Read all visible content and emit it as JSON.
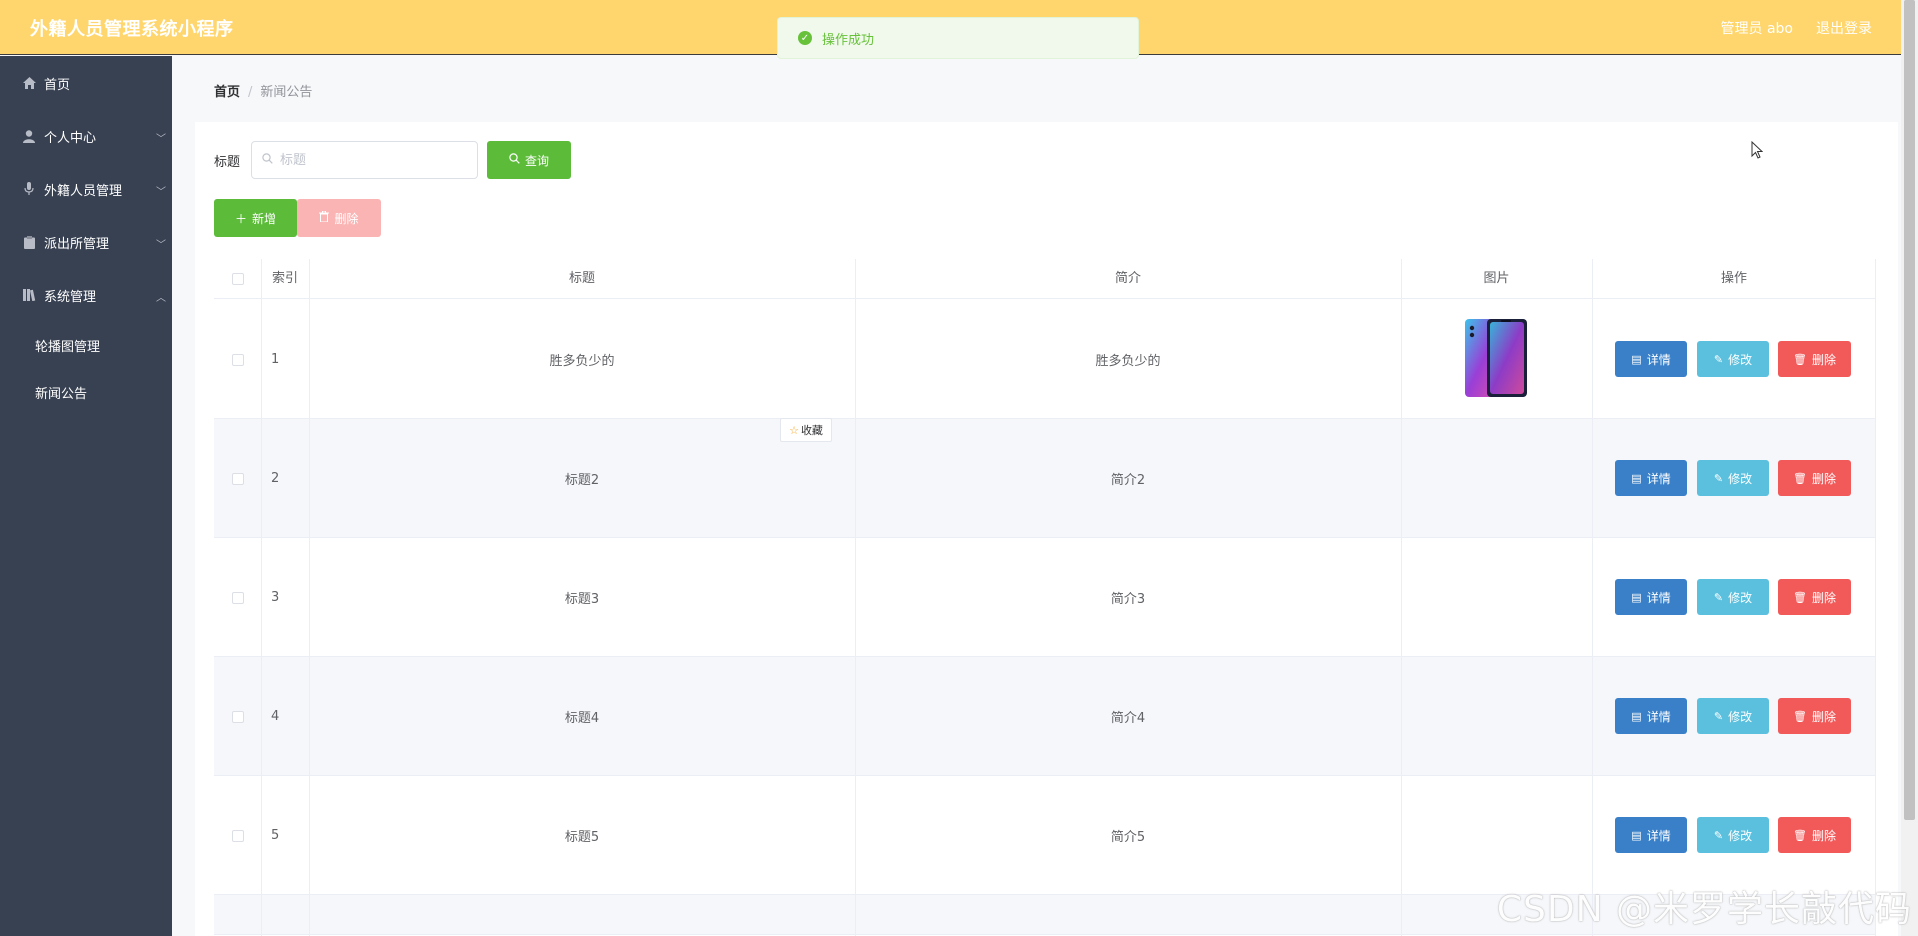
{
  "header": {
    "title": "外籍人员管理系统小程序",
    "admin": "管理员 abo",
    "logout": "退出登录"
  },
  "toast": {
    "message": "操作成功"
  },
  "sidebar": {
    "items": [
      {
        "label": "首页",
        "icon": "home-icon"
      },
      {
        "label": "个人中心",
        "icon": "user-icon"
      },
      {
        "label": "外籍人员管理",
        "icon": "microphone-icon"
      },
      {
        "label": "派出所管理",
        "icon": "clipboard-icon"
      },
      {
        "label": "系统管理",
        "icon": "library-icon"
      }
    ],
    "subitems": [
      {
        "label": "轮播图管理"
      },
      {
        "label": "新闻公告"
      }
    ]
  },
  "breadcrumb": {
    "home": "首页",
    "separator": "/",
    "current": "新闻公告"
  },
  "search": {
    "label": "标题",
    "placeholder": "标题",
    "value": "",
    "query_button": "查询"
  },
  "toolbar": {
    "add_button": "新增",
    "delete_button": "删除"
  },
  "table": {
    "headers": [
      "索引",
      "标题",
      "简介",
      "图片",
      "操作"
    ],
    "rows": [
      {
        "index": "1",
        "title": "胜多负少的",
        "intro": "胜多负少的",
        "has_image": true
      },
      {
        "index": "2",
        "title": "标题2",
        "intro": "简介2",
        "has_image": false
      },
      {
        "index": "3",
        "title": "标题3",
        "intro": "简介3",
        "has_image": false
      },
      {
        "index": "4",
        "title": "标题4",
        "intro": "简介4",
        "has_image": false
      },
      {
        "index": "5",
        "title": "标题5",
        "intro": "简介5",
        "has_image": false
      }
    ],
    "actions": {
      "detail": "详情",
      "edit": "修改",
      "delete": "删除"
    }
  },
  "tooltip": {
    "favorite": "收藏"
  },
  "watermark": "CSDN @米罗学长敲代码",
  "colors": {
    "header_bg": "#ffd66e",
    "sidebar_bg": "#384152",
    "success": "#5cbc3a",
    "primary": "#3a80c8",
    "info": "#5bc0de",
    "danger": "#f25a5a"
  }
}
